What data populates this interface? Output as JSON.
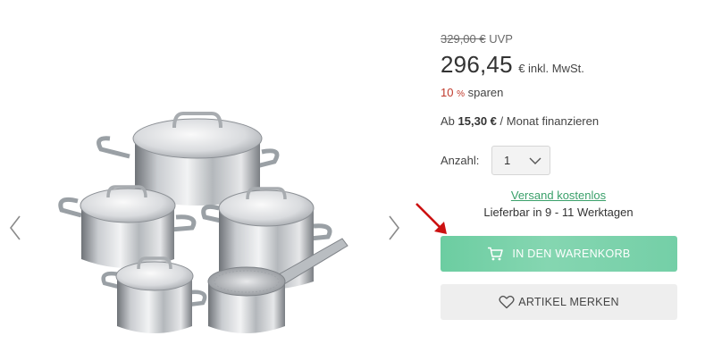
{
  "gallery": {
    "prev_icon": "chevron-left-icon",
    "next_icon": "chevron-right-icon",
    "image_subject": "cookware-set"
  },
  "pricing": {
    "old_price": "329,00 €",
    "old_price_suffix": "UVP",
    "price": "296,45",
    "price_suffix": "€ inkl. MwSt.",
    "savings_percent": "10",
    "savings_percent_sign": "%",
    "savings_text": "sparen",
    "savings_color": "#c0392b"
  },
  "finance": {
    "prefix": "Ab",
    "amount": "15,30 €",
    "suffix": "/ Monat finanzieren"
  },
  "quantity": {
    "label": "Anzahl:",
    "value": "1",
    "icon": "chevron-down-icon"
  },
  "shipping": {
    "link": "Versand kostenlos",
    "delivery": "Lieferbar in 9 - 11 Werktagen",
    "link_color": "#3aa06a"
  },
  "actions": {
    "add_to_cart": "IN DEN WARENKORB",
    "add_to_cart_icon": "cart-icon",
    "add_to_cart_color": "#74cfa7",
    "wishlist": "ARTIKEL MERKEN",
    "wishlist_icon": "heart-icon"
  },
  "annotation": {
    "arrow_color": "#cc1111"
  }
}
